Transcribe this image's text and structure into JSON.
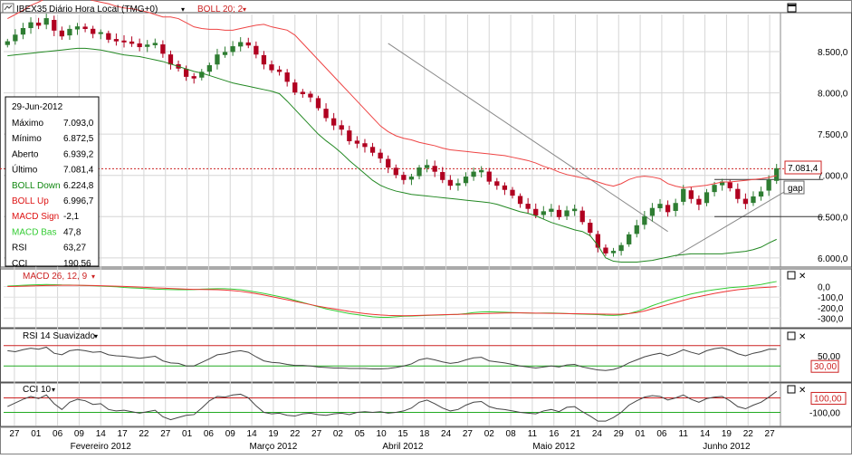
{
  "header": {
    "symbol": "IBEX35",
    "period": "Diário Hora Local (TMG+0)",
    "indicator": "BOLL 20; 2"
  },
  "panels": {
    "macd_label": "MACD 26, 12, 9",
    "rsi_label": "RSI 14 Suavizado",
    "cci_label": "CCI 10"
  },
  "info_box": {
    "date": "29-Jun-2012",
    "rows": [
      {
        "label": "Máximo",
        "value": "7.093,0",
        "color": "#000000"
      },
      {
        "label": "Mínimo",
        "value": "6.872,5",
        "color": "#000000"
      },
      {
        "label": "Aberto",
        "value": "6.939,2",
        "color": "#000000"
      },
      {
        "label": "Último",
        "value": "7.081,4",
        "color": "#000000"
      },
      {
        "label": "BOLL Down",
        "value": "6.224,8",
        "color": "#118811"
      },
      {
        "label": "BOLL Up",
        "value": "6.996,7",
        "color": "#dd1111"
      },
      {
        "label": "MACD Sign",
        "value": "-2,1",
        "color": "#dd1111"
      },
      {
        "label": "MACD Bas",
        "value": "47,8",
        "color": "#33cc33"
      },
      {
        "label": "RSI",
        "value": "63,27",
        "color": "#000000"
      },
      {
        "label": "CCI",
        "value": "190,56",
        "color": "#000000"
      }
    ]
  },
  "annotations": {
    "last_price": "7.081,4",
    "gap": "gap"
  },
  "chart_data": [
    {
      "type": "candlestick",
      "name": "IBEX35",
      "ylim": [
        5900,
        8950
      ],
      "yticks": [
        "8.500,0",
        "8.000,0",
        "7.500,0",
        "7.000,0",
        "6.500,0",
        "6.000,0"
      ],
      "ytick_values": [
        8500,
        8000,
        7500,
        7000,
        6500,
        6000
      ],
      "grid": true,
      "close": [
        8620,
        8700,
        8780,
        8850,
        8820,
        8900,
        8760,
        8690,
        8770,
        8800,
        8780,
        8720,
        8730,
        8650,
        8630,
        8620,
        8600,
        8560,
        8580,
        8600,
        8480,
        8350,
        8300,
        8200,
        8180,
        8250,
        8330,
        8460,
        8490,
        8560,
        8610,
        8580,
        8470,
        8350,
        8280,
        8260,
        8140,
        8010,
        7990,
        7950,
        7820,
        7700,
        7610,
        7560,
        7420,
        7390,
        7350,
        7280,
        7210,
        7100,
        7010,
        6950,
        6980,
        7090,
        7120,
        7050,
        6950,
        6880,
        6900,
        6980,
        7040,
        7060,
        6930,
        6880,
        6830,
        6760,
        6660,
        6600,
        6520,
        6560,
        6590,
        6500,
        6570,
        6590,
        6440,
        6310,
        6130,
        6060,
        6080,
        6150,
        6280,
        6390,
        6500,
        6600,
        6650,
        6560,
        6660,
        6830,
        6720,
        6650,
        6790,
        6880,
        6920,
        6850,
        6720,
        6660,
        6740,
        6800,
        6940,
        7081
      ],
      "dates": [
        "27",
        "01",
        "06",
        "09",
        "14",
        "17",
        "22",
        "27",
        "01",
        "06",
        "09",
        "14",
        "19",
        "22",
        "27",
        "02",
        "05",
        "10",
        "15",
        "18",
        "24",
        "27",
        "02",
        "08",
        "11",
        "16",
        "21",
        "24",
        "29",
        "01",
        "06",
        "11",
        "14",
        "19",
        "22",
        "27"
      ],
      "months": [
        "Fevereiro 2012",
        "Março 2012",
        "Abril 2012",
        "Maio 2012",
        "Junho 2012"
      ]
    },
    {
      "type": "line",
      "name": "BOLL Up",
      "values": [
        8900,
        8950,
        9000,
        9060,
        9100,
        9150,
        9160,
        9170,
        9180,
        9170,
        9150,
        9120,
        9100,
        9080,
        9050,
        9030,
        9020,
        9000,
        8980,
        8950,
        8920,
        8920,
        8900,
        8850,
        8800,
        8780,
        8770,
        8770,
        8760,
        8760,
        8780,
        8800,
        8820,
        8830,
        8800,
        8780,
        8760,
        8700,
        8600,
        8500,
        8400,
        8300,
        8200,
        8100,
        8000,
        7900,
        7800,
        7700,
        7600,
        7530,
        7480,
        7450,
        7430,
        7400,
        7380,
        7360,
        7330,
        7310,
        7300,
        7290,
        7280,
        7270,
        7260,
        7250,
        7240,
        7220,
        7200,
        7180,
        7150,
        7110,
        7080,
        7040,
        7010,
        6990,
        6970,
        6950,
        6920,
        6890,
        6870,
        6900,
        6950,
        6980,
        6990,
        6980,
        6960,
        6900,
        6870,
        6850,
        6860,
        6870,
        6880,
        6900,
        6920,
        6920,
        6930,
        6940,
        6950,
        6960,
        6975,
        6997
      ]
    },
    {
      "type": "line",
      "name": "BOLL Down",
      "values": [
        8450,
        8460,
        8470,
        8480,
        8490,
        8500,
        8510,
        8520,
        8530,
        8540,
        8540,
        8530,
        8520,
        8500,
        8480,
        8460,
        8450,
        8440,
        8420,
        8400,
        8380,
        8350,
        8320,
        8290,
        8260,
        8240,
        8210,
        8180,
        8150,
        8120,
        8100,
        8080,
        8060,
        8040,
        8020,
        7990,
        7900,
        7800,
        7700,
        7600,
        7500,
        7420,
        7350,
        7270,
        7180,
        7100,
        7020,
        6940,
        6880,
        6840,
        6810,
        6790,
        6770,
        6760,
        6750,
        6740,
        6730,
        6720,
        6710,
        6700,
        6690,
        6680,
        6670,
        6650,
        6620,
        6590,
        6560,
        6540,
        6510,
        6470,
        6430,
        6400,
        6370,
        6340,
        6320,
        6270,
        6150,
        6000,
        5960,
        5950,
        5950,
        5950,
        5960,
        5970,
        5990,
        6010,
        6030,
        6040,
        6050,
        6050,
        6050,
        6050,
        6050,
        6060,
        6070,
        6080,
        6100,
        6130,
        6180,
        6225
      ]
    },
    {
      "type": "line",
      "name": "MACD",
      "ylim": [
        -380,
        150
      ],
      "yticks": [
        "0,0",
        "-100,0",
        "-200,0",
        "-300,0"
      ],
      "ytick_values": [
        0,
        -100,
        -200,
        -300
      ],
      "series": [
        {
          "name": "MACD Bas",
          "values": [
            5,
            8,
            12,
            15,
            18,
            20,
            18,
            15,
            14,
            12,
            10,
            8,
            5,
            2,
            -2,
            -8,
            -12,
            -16,
            -20,
            -24,
            -26,
            -28,
            -30,
            -30,
            -28,
            -24,
            -22,
            -20,
            -20,
            -24,
            -30,
            -40,
            -52,
            -65,
            -80,
            -95,
            -110,
            -130,
            -150,
            -170,
            -190,
            -210,
            -225,
            -240,
            -255,
            -265,
            -275,
            -285,
            -290,
            -290,
            -285,
            -280,
            -278,
            -275,
            -272,
            -270,
            -268,
            -265,
            -262,
            -255,
            -245,
            -240,
            -238,
            -240,
            -242,
            -245,
            -248,
            -250,
            -252,
            -250,
            -250,
            -252,
            -255,
            -258,
            -260,
            -262,
            -265,
            -270,
            -272,
            -268,
            -255,
            -235,
            -210,
            -180,
            -155,
            -130,
            -110,
            -90,
            -70,
            -55,
            -40,
            -30,
            -20,
            -10,
            -5,
            0,
            10,
            20,
            35,
            48
          ]
        },
        {
          "name": "MACD Sign",
          "values": [
            0,
            2,
            4,
            6,
            8,
            10,
            11,
            12,
            12,
            12,
            11,
            10,
            8,
            6,
            4,
            1,
            -2,
            -5,
            -8,
            -12,
            -15,
            -18,
            -21,
            -24,
            -26,
            -27,
            -28,
            -30,
            -33,
            -38,
            -45,
            -55,
            -67,
            -80,
            -95,
            -110,
            -125,
            -140,
            -155,
            -170,
            -185,
            -198,
            -210,
            -222,
            -235,
            -245,
            -255,
            -262,
            -268,
            -272,
            -274,
            -275,
            -274,
            -272,
            -270,
            -268,
            -266,
            -264,
            -262,
            -260,
            -258,
            -256,
            -254,
            -252,
            -250,
            -249,
            -249,
            -250,
            -251,
            -252,
            -253,
            -254,
            -255,
            -256,
            -257,
            -258,
            -259,
            -260,
            -261,
            -260,
            -255,
            -245,
            -230,
            -210,
            -190,
            -170,
            -150,
            -130,
            -110,
            -95,
            -80,
            -65,
            -52,
            -40,
            -30,
            -22,
            -15,
            -10,
            -6,
            -2
          ]
        }
      ]
    },
    {
      "type": "line",
      "name": "RSI 14",
      "ylim": [
        0,
        100
      ],
      "yticks": [
        "50,00",
        "30,00"
      ],
      "ytick_values": [
        50,
        30
      ],
      "levels": [
        70,
        30
      ],
      "values": [
        60,
        58,
        62,
        65,
        63,
        67,
        55,
        52,
        60,
        62,
        60,
        57,
        58,
        52,
        50,
        49,
        47,
        45,
        47,
        49,
        40,
        36,
        35,
        30,
        30,
        37,
        44,
        52,
        54,
        58,
        60,
        57,
        48,
        40,
        37,
        36,
        33,
        31,
        31,
        30,
        28,
        27,
        26,
        26,
        25,
        25,
        25,
        24,
        24,
        25,
        27,
        30,
        34,
        42,
        45,
        42,
        38,
        35,
        37,
        42,
        46,
        47,
        40,
        38,
        36,
        33,
        30,
        28,
        26,
        28,
        30,
        28,
        32,
        33,
        28,
        25,
        22,
        21,
        23,
        28,
        36,
        42,
        48,
        52,
        55,
        50,
        55,
        62,
        57,
        53,
        60,
        64,
        66,
        61,
        54,
        50,
        55,
        58,
        63,
        63
      ]
    },
    {
      "type": "line",
      "name": "CCI 10",
      "ylim": [
        -280,
        280
      ],
      "yticks": [
        "100,00",
        "-100,00"
      ],
      "ytick_values": [
        100,
        -100
      ],
      "levels": [
        100,
        -100
      ],
      "values": [
        -20,
        30,
        80,
        120,
        90,
        140,
        20,
        -60,
        40,
        80,
        60,
        10,
        20,
        -60,
        -80,
        -70,
        -90,
        -110,
        -90,
        -70,
        -160,
        -200,
        -170,
        -140,
        -130,
        -40,
        60,
        120,
        110,
        140,
        150,
        100,
        -10,
        -100,
        -120,
        -110,
        -140,
        -150,
        -120,
        -110,
        -130,
        -140,
        -120,
        -110,
        -130,
        -100,
        -90,
        -100,
        -90,
        -110,
        -100,
        -80,
        -40,
        40,
        70,
        20,
        -40,
        -80,
        -60,
        0,
        40,
        50,
        -20,
        -50,
        -60,
        -80,
        -100,
        -110,
        -120,
        -80,
        -60,
        -90,
        -30,
        -20,
        -90,
        -150,
        -220,
        -220,
        -170,
        -100,
        0,
        60,
        110,
        130,
        120,
        70,
        100,
        140,
        80,
        40,
        90,
        110,
        120,
        60,
        -20,
        -50,
        0,
        40,
        110,
        190
      ]
    }
  ]
}
